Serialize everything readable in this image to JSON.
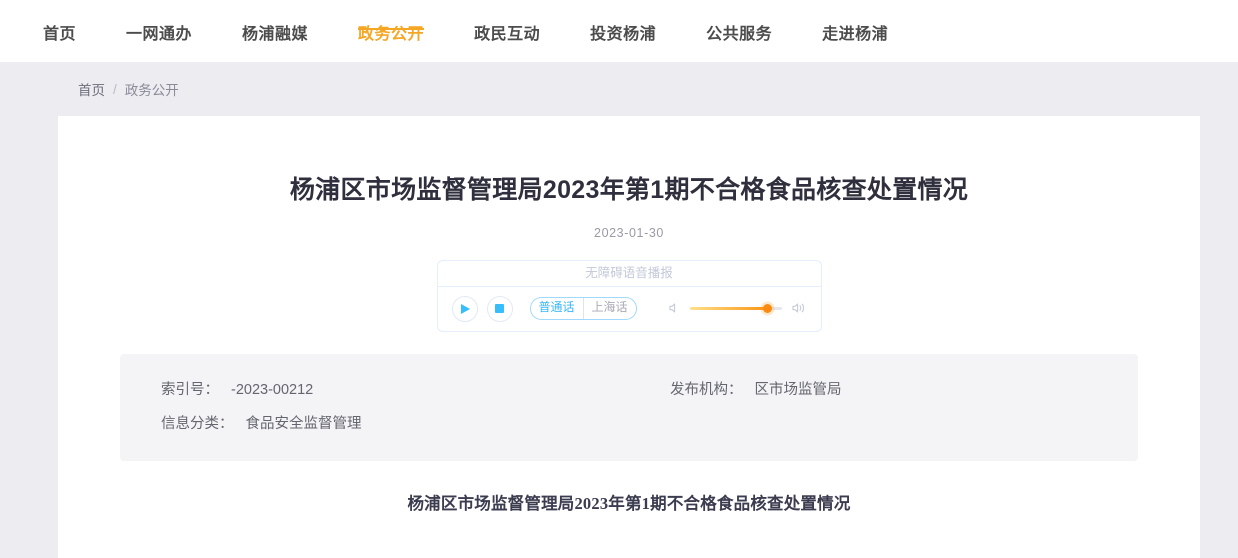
{
  "header": {
    "nav": [
      {
        "label": "首页",
        "active": false
      },
      {
        "label": "一网通办",
        "active": false
      },
      {
        "label": "杨浦融媒",
        "active": false
      },
      {
        "label": "政务公开",
        "active": true
      },
      {
        "label": "政民互动",
        "active": false
      },
      {
        "label": "投资杨浦",
        "active": false
      },
      {
        "label": "公共服务",
        "active": false
      },
      {
        "label": "走进杨浦",
        "active": false
      }
    ],
    "accent_color": "#f5a623",
    "text_color": "#4c4c4c"
  },
  "breadcrumb": {
    "home": "首页",
    "separator": "/",
    "current": "政务公开"
  },
  "document": {
    "title": "杨浦区市场监督管理局2023年第1期不合格食品核查处置情况",
    "date": "2023-01-30"
  },
  "audio_player": {
    "header_label": "无障碍语音播报",
    "play_icon": "play-icon",
    "stop_icon": "stop-icon",
    "languages": [
      {
        "label": "普通话",
        "selected": true
      },
      {
        "label": "上海话",
        "selected": false
      }
    ],
    "volume_percent": 85,
    "mute_icon": "speaker-mute-icon",
    "volume_icon": "speaker-on-icon",
    "accent_color": "#36bdfb",
    "slider_color": "#fb8a12"
  },
  "meta": {
    "left": [
      {
        "label": "索引号：",
        "value": "-2023-00212"
      },
      {
        "label": "信息分类：",
        "value": "食品安全监督管理"
      }
    ],
    "right": [
      {
        "label": "发布机构：",
        "value": "区市场监管局"
      }
    ]
  },
  "article": {
    "heading": "杨浦区市场监督管理局2023年第1期不合格食品核查处置情况"
  }
}
